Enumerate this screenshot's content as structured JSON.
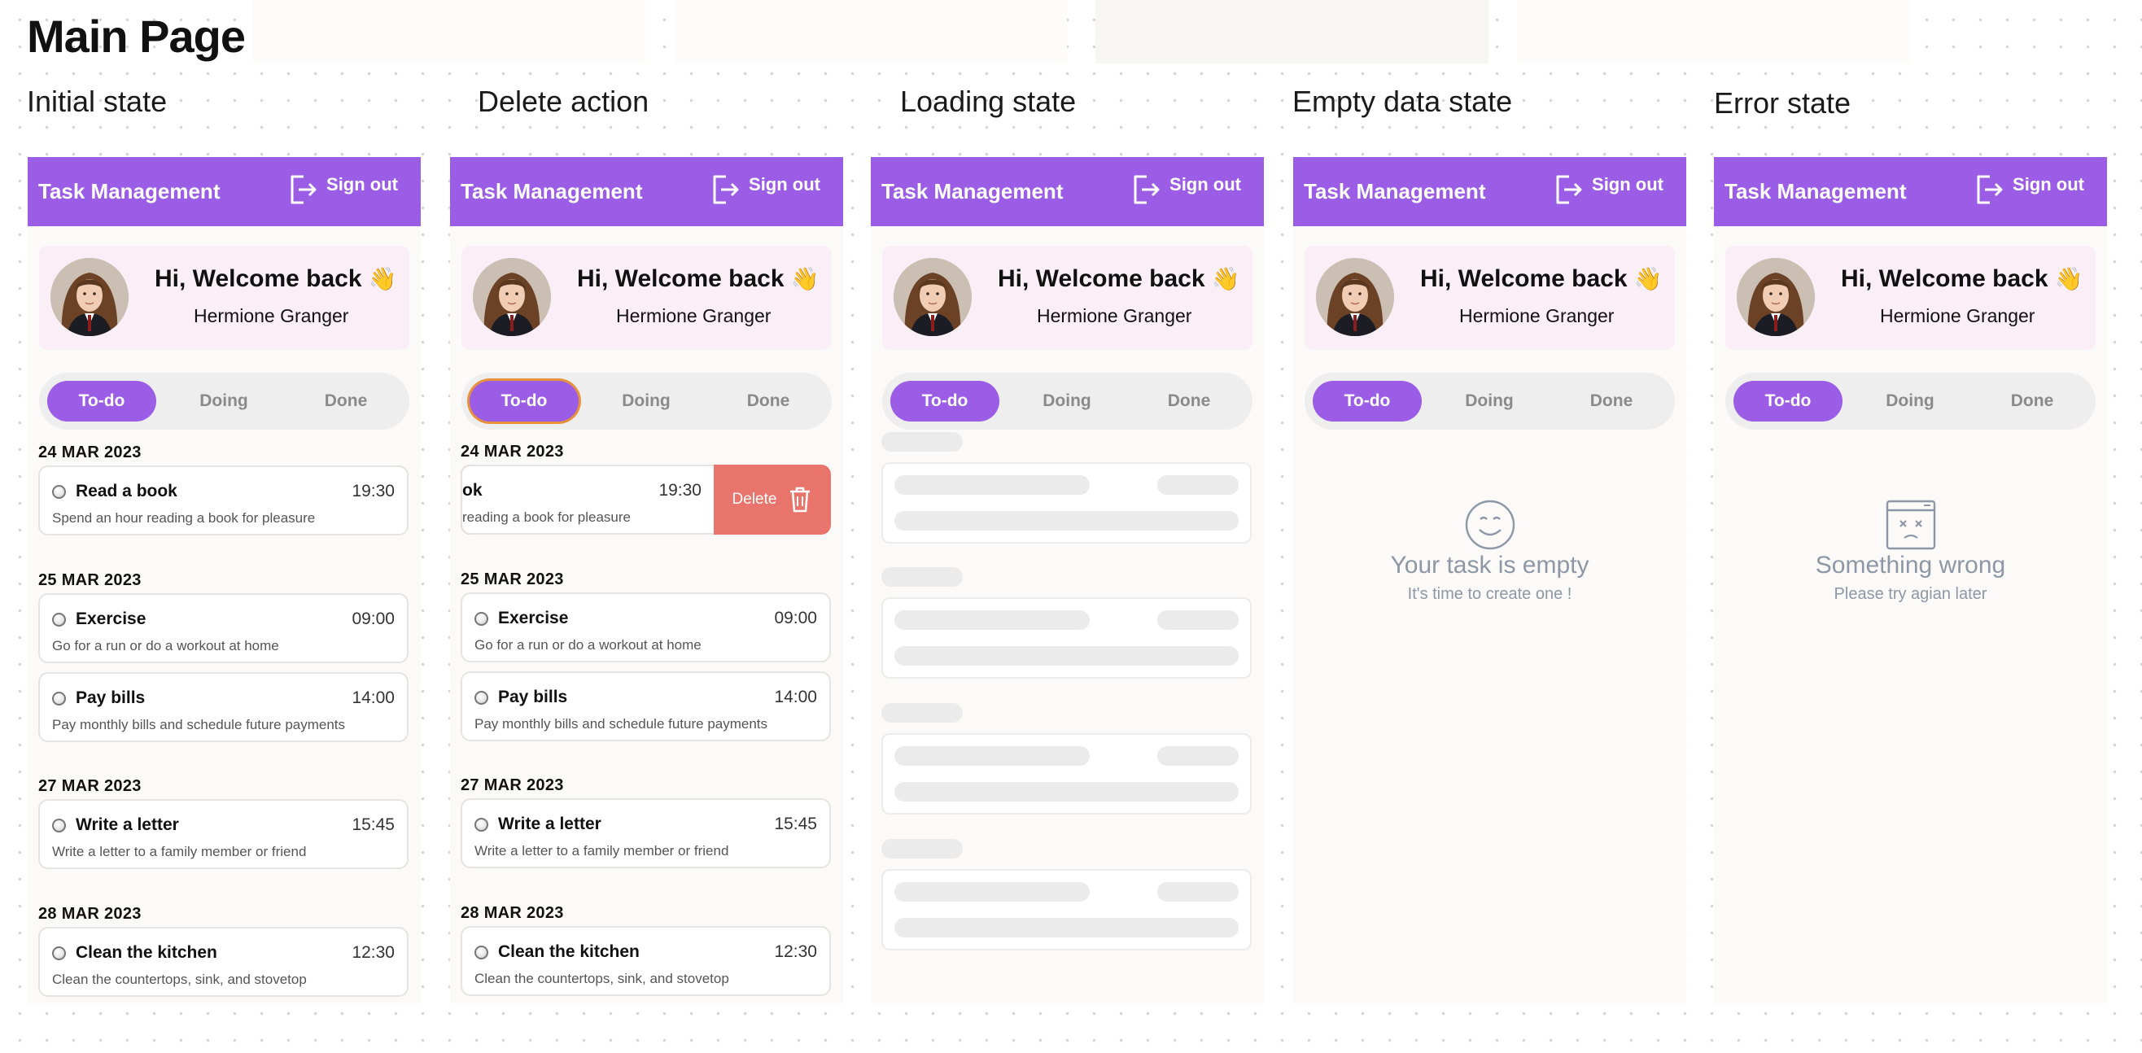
{
  "page": {
    "title": "Main Page"
  },
  "frames": [
    {
      "label": "Initial state"
    },
    {
      "label": "Delete action"
    },
    {
      "label": "Loading state"
    },
    {
      "label": "Empty data state"
    },
    {
      "label": "Error state"
    }
  ],
  "app": {
    "title": "Task Management",
    "signout_label": "Sign out",
    "greeting": "Hi, Welcome back",
    "wave_emoji": "👋",
    "user_name": "Hermione Granger",
    "tabs": [
      "To-do",
      "Doing",
      "Done"
    ],
    "accent_color": "#9b5de5",
    "delete_color": "#e8746b"
  },
  "task_groups": [
    {
      "date": "24 MAR 2023",
      "tasks": [
        {
          "title": "Read a book",
          "desc": "Spend an hour reading a book for pleasure",
          "time": "19:30"
        }
      ]
    },
    {
      "date": "25 MAR 2023",
      "tasks": [
        {
          "title": "Exercise",
          "desc": "Go for a run or do a workout at home",
          "time": "09:00"
        },
        {
          "title": "Pay bills",
          "desc": "Pay monthly bills and schedule future payments",
          "time": "14:00"
        }
      ]
    },
    {
      "date": "27 MAR 2023",
      "tasks": [
        {
          "title": "Write a letter",
          "desc": "Write a letter to a family member or friend",
          "time": "15:45"
        }
      ]
    },
    {
      "date": "28 MAR 2023",
      "tasks": [
        {
          "title": "Clean the kitchen",
          "desc": "Clean the countertops, sink, and stovetop",
          "time": "12:30"
        }
      ]
    }
  ],
  "delete_action": {
    "partial_title": "ok",
    "partial_desc": "reading a book for pleasure",
    "time": "19:30",
    "delete_label": "Delete"
  },
  "empty_state": {
    "icon": "smile-icon",
    "title": "Your task is empty",
    "subtitle": "It's time to create one !"
  },
  "error_state": {
    "icon": "broken-window-icon",
    "title": "Something wrong",
    "subtitle": "Please try agian later"
  }
}
